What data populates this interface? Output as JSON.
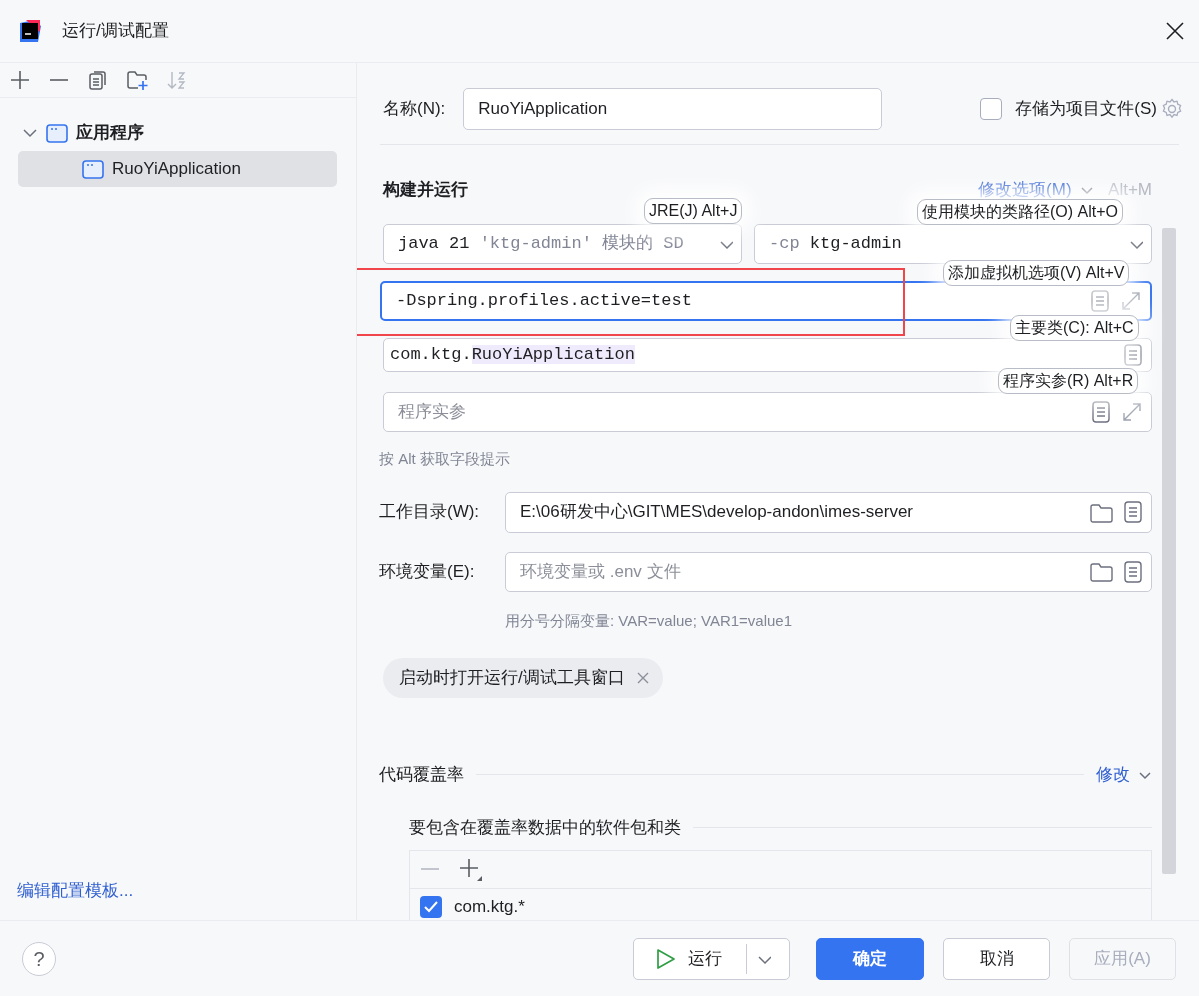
{
  "window": {
    "title": "运行/调试配置"
  },
  "sidebar": {
    "toolbar": [
      {
        "kind": "add",
        "disabled": false
      },
      {
        "kind": "remove",
        "disabled": false
      },
      {
        "kind": "copy",
        "disabled": false
      },
      {
        "kind": "new-folder",
        "disabled": false
      },
      {
        "kind": "sort",
        "disabled": true
      }
    ],
    "tree": [
      {
        "label": "应用程序",
        "expanded": true,
        "selected": false,
        "children": [
          {
            "label": "RuoYiApplication",
            "selected": true
          }
        ]
      }
    ],
    "template_link": "编辑配置模板..."
  },
  "name_field": {
    "label": "名称(N):",
    "value": "RuoYiApplication"
  },
  "store_as_project_file": {
    "label": "存储为项目文件(S)",
    "checked": false
  },
  "build_and_run": {
    "title": "构建并运行",
    "modify_options": "修改选项(M)",
    "modify_shortcut": "Alt+M",
    "jre": {
      "value": "java 21",
      "detail": "'ktg-admin' 模块的 SD"
    },
    "classpath": {
      "prefix": "-cp",
      "value": "ktg-admin"
    },
    "vm_options": {
      "value": "-Dspring.profiles.active=test",
      "focused": true,
      "highlighted": true
    },
    "main_class": {
      "package": "com.ktg.",
      "class_name": "RuoYiApplication"
    },
    "program_args": {
      "placeholder": "程序实参"
    },
    "hint": "按 Alt 获取字段提示"
  },
  "hints": [
    {
      "kind": "jre",
      "text": "JRE(J) Alt+J"
    },
    {
      "kind": "classpath",
      "text": "使用模块的类路径(O) Alt+O"
    },
    {
      "kind": "vm",
      "text": "添加虚拟机选项(V) Alt+V"
    },
    {
      "kind": "main",
      "text": "主要类(C): Alt+C"
    },
    {
      "kind": "args",
      "text": "程序实参(R) Alt+R"
    }
  ],
  "working_dir": {
    "label": "工作目录(W):",
    "value": "E:\\06研发中心\\GIT\\MES\\develop-andon\\imes-server"
  },
  "env_vars": {
    "label": "环境变量(E):",
    "placeholder": "环境变量或 .env 文件",
    "help": "用分号分隔变量: VAR=value; VAR1=value1"
  },
  "option_chips": [
    {
      "label": "启动时打开运行/调试工具窗口"
    }
  ],
  "coverage": {
    "title": "代码覆盖率",
    "modify": "修改",
    "subtitle": "要包含在覆盖率数据中的软件包和类",
    "toolbar": [
      {
        "kind": "remove",
        "disabled": true
      },
      {
        "kind": "add",
        "disabled": false
      }
    ],
    "rows": [
      {
        "pattern": "com.ktg.*",
        "checked": true
      }
    ]
  },
  "footer": {
    "help": "?",
    "buttons": [
      {
        "kind": "run",
        "label": "运行",
        "disabled": false
      },
      {
        "kind": "primary",
        "label": "确定",
        "disabled": false
      },
      {
        "kind": "default",
        "label": "取消",
        "disabled": false
      },
      {
        "kind": "default",
        "label": "应用(A)",
        "disabled": true
      }
    ]
  }
}
